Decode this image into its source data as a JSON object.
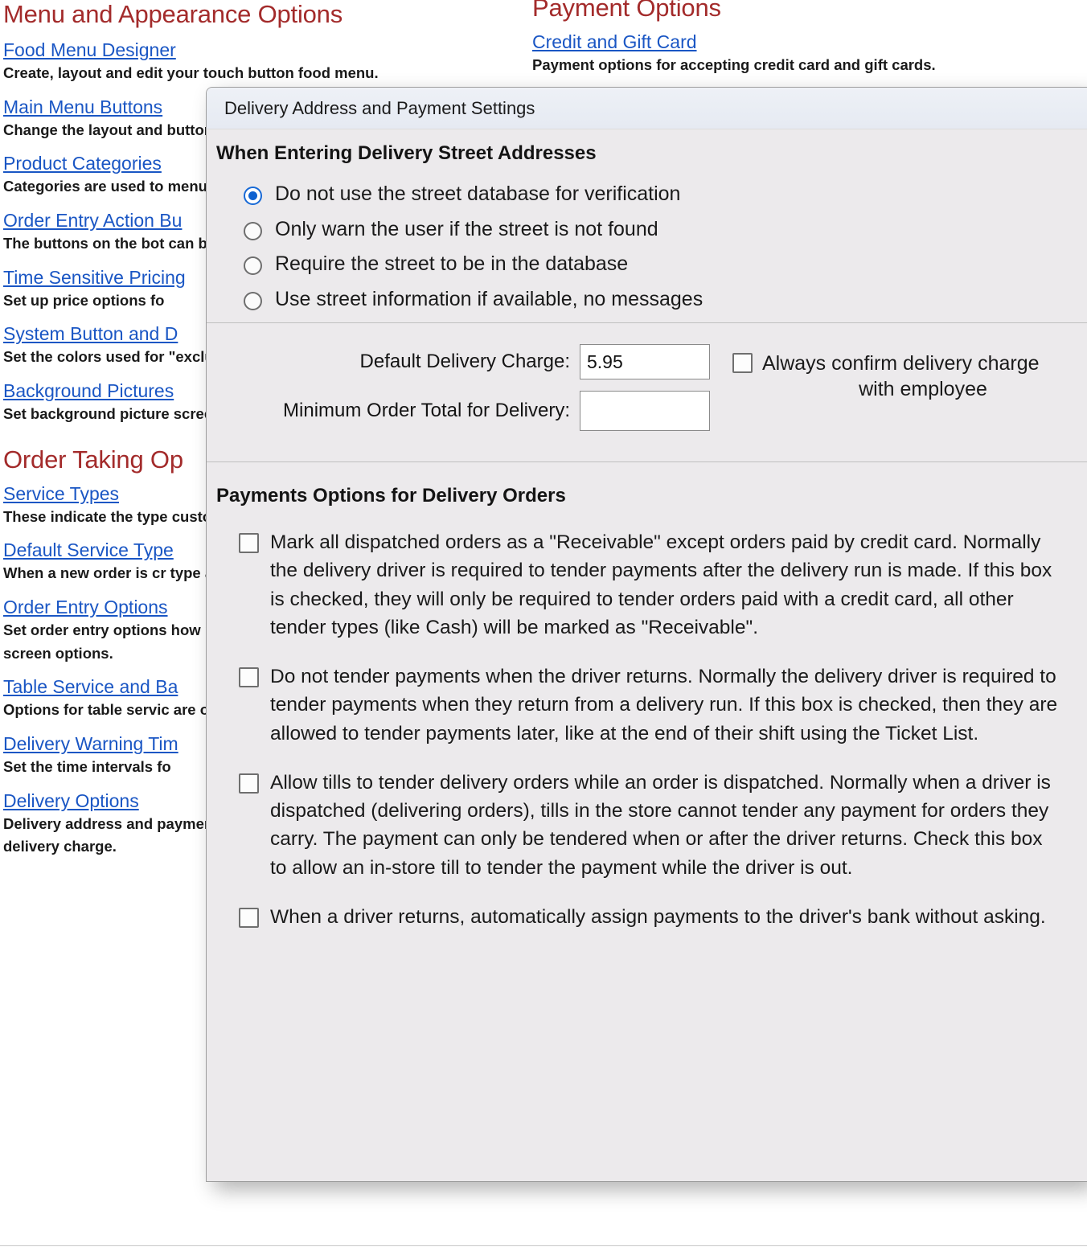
{
  "background": {
    "left_column": {
      "section_title": "Menu and Appearance Options",
      "entries": [
        {
          "link": "Food Menu Designer",
          "desc": "Create, layout and edit your touch button food menu."
        },
        {
          "link": "Main Menu Buttons",
          "desc": "Change the layout and buttons in the Order p"
        },
        {
          "link": "Product Categories",
          "desc": "Categories are used to menu items and produ"
        },
        {
          "link": "Order Entry Action Bu",
          "desc": "The buttons on the bot can be customized."
        },
        {
          "link": "Time Sensitive Pricing",
          "desc": "Set up price options fo"
        },
        {
          "link": "System Button and D",
          "desc": "Set the colors used for \"excluded\" and \"require promise time warnings"
        },
        {
          "link": "Background Pictures",
          "desc": "Set background picture screen and order entry"
        }
      ],
      "section_title_2": "Order Taking Op",
      "entries_2": [
        {
          "link": "Service Types",
          "desc": "These indicate the type customers, such as, Dir Delivery."
        },
        {
          "link": "Default Service Type",
          "desc": "When a new order is cr type assigned to it."
        },
        {
          "link": "Order Entry Options",
          "desc": "Set order entry options how modifiers print on future orders, guest co screen options."
        },
        {
          "link": "Table Service and Ba",
          "desc": "Options for table servic are options for coursin the fresh list, table pos"
        },
        {
          "link": "Delivery Warning Tim",
          "desc": "Set the time intervals fo"
        },
        {
          "link": "Delivery Options",
          "desc": "Delivery address and payment settings, including the default delivery charge."
        }
      ]
    },
    "right_column": {
      "section_title": "Payment Options",
      "entries": [
        {
          "link": "Credit and Gift Card",
          "desc": "Payment options for accepting credit card and gift cards."
        }
      ]
    }
  },
  "dialog": {
    "title": "Delivery Address and Payment Settings",
    "street_group": {
      "heading": "When Entering Delivery Street Addresses",
      "selected_index": 0,
      "options": [
        "Do not use the street database for verification",
        "Only warn the user if the street is not found",
        "Require the street to be in the database",
        "Use street information if available, no messages"
      ]
    },
    "charges": {
      "default_delivery_charge_label": "Default Delivery Charge:",
      "default_delivery_charge_value": "5.95",
      "minimum_order_total_label": "Minimum Order Total for Delivery:",
      "minimum_order_total_value": "",
      "confirm_checkbox_line1": "Always confirm delivery charge",
      "confirm_checkbox_line2": "with employee",
      "confirm_checked": false
    },
    "payments_group": {
      "heading": "Payments Options for Delivery Orders",
      "options": [
        {
          "checked": false,
          "text": "Mark all dispatched orders as a \"Receivable\" except orders paid by credit card. Normally the delivery driver is required to tender payments after the delivery run is made. If this box is checked, they will only be required to tender orders paid with a credit card, all other tender types (like Cash) will be marked as \"Receivable\"."
        },
        {
          "checked": false,
          "text": "Do not tender payments when the driver returns. Normally the delivery driver is required to tender payments when they return from a delivery run. If this box is checked, then they are allowed to tender payments later, like at the end of their shift using the Ticket List."
        },
        {
          "checked": false,
          "text": "Allow tills to tender delivery orders while an order is dispatched. Normally when a driver is dispatched (delivering orders), tills in the store cannot tender any payment for orders they carry. The payment can only be tendered when or after the driver returns. Check this box to allow an in-store till to tender the payment while the driver is out."
        },
        {
          "checked": false,
          "text": "When a driver returns, automatically assign payments to the driver's bank without asking."
        }
      ]
    }
  },
  "colors": {
    "section_heading": "#a32b2b",
    "link": "#1a56c4",
    "dialog_background": "#eceaec",
    "radio_accent": "#0f62d0"
  }
}
